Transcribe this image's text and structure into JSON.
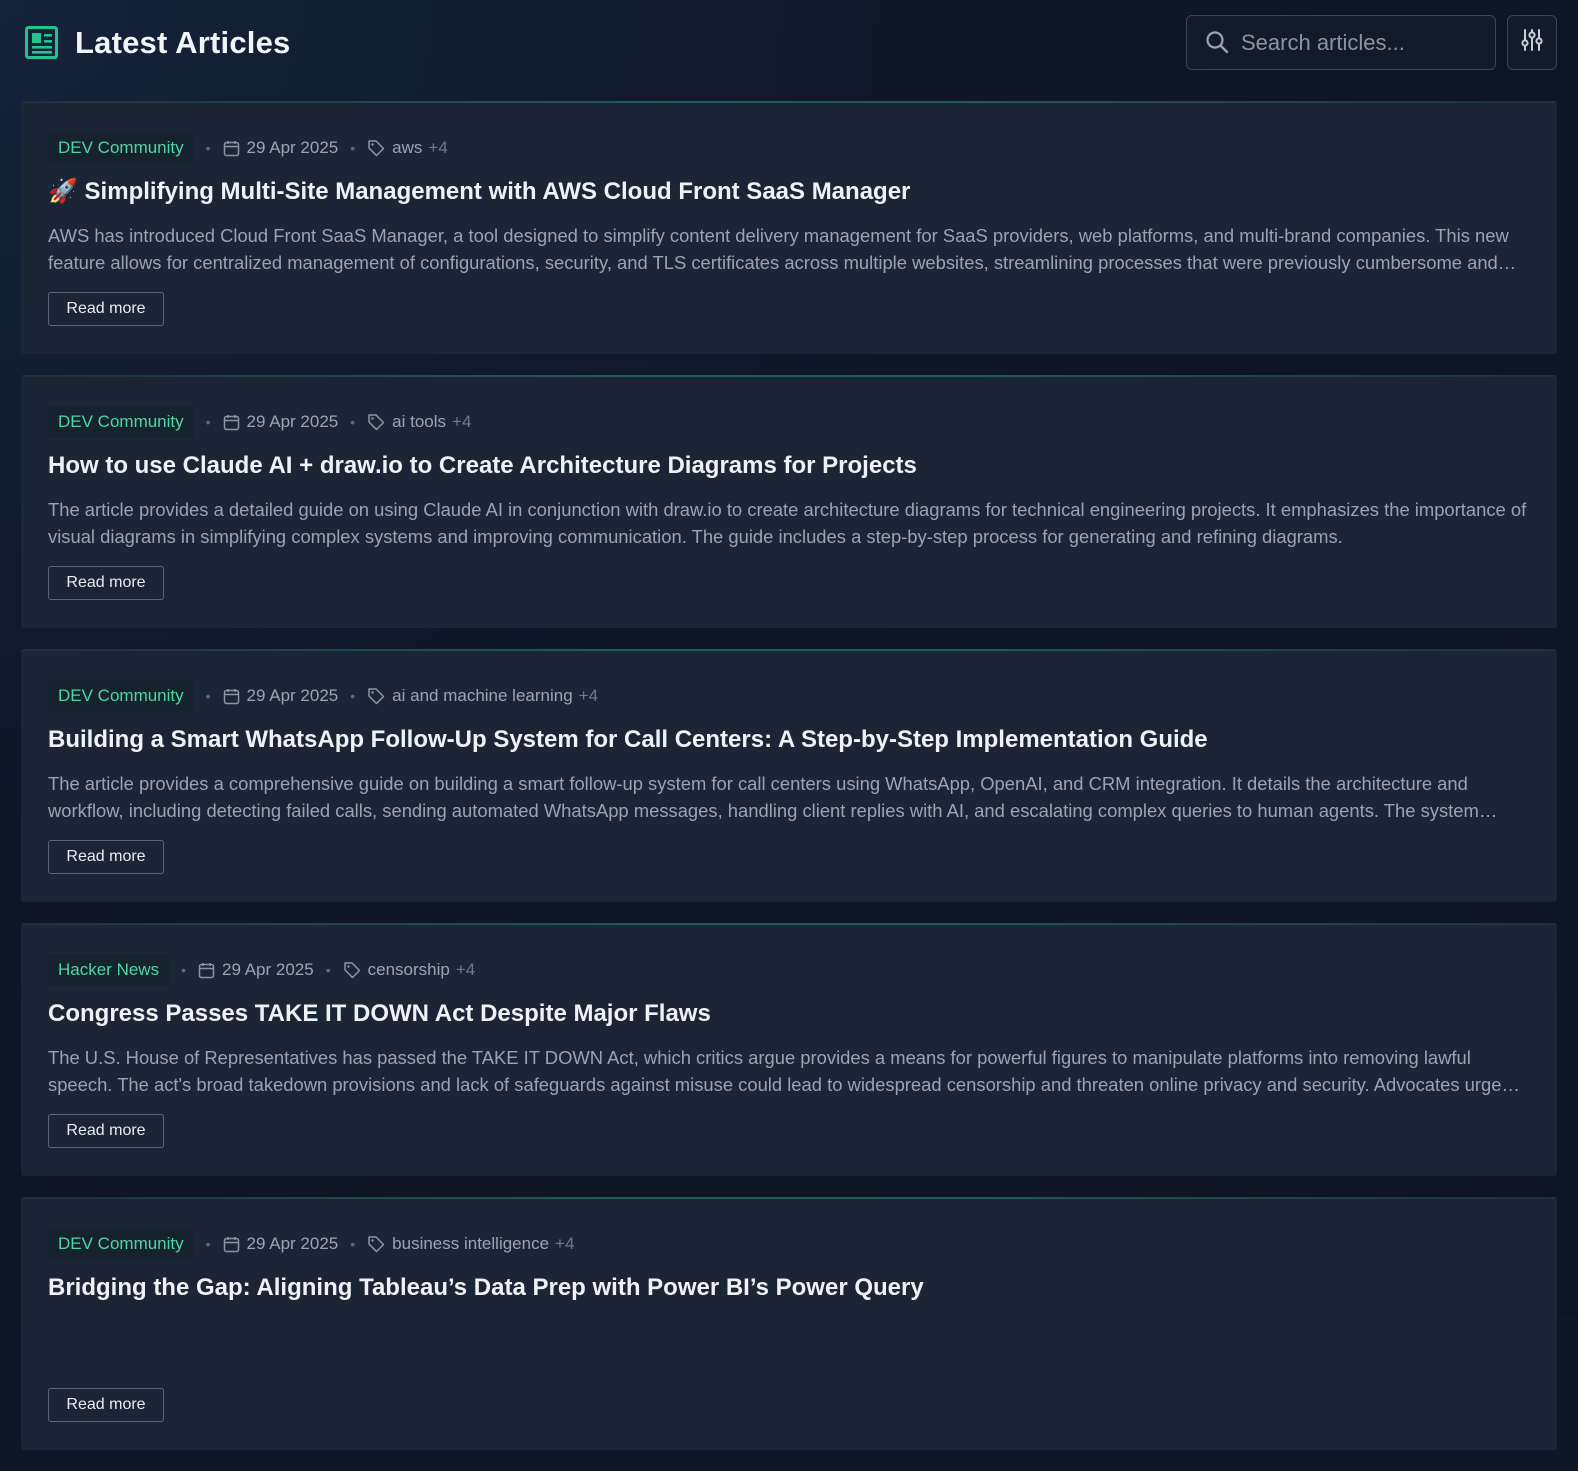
{
  "header": {
    "title": "Latest Articles",
    "logo_icon": "newspaper-icon",
    "search": {
      "placeholder": "Search articles...",
      "value": ""
    },
    "filter_icon": "sliders-icon"
  },
  "colors": {
    "accent": "#4fd6a3",
    "background": "#0f1726",
    "card": "#1c2536"
  },
  "articles": [
    {
      "source": "DEV Community",
      "date": "29 Apr 2025",
      "tag": "aws",
      "more_tags": "+4",
      "title": "🚀 Simplifying Multi-Site Management with AWS Cloud Front SaaS Manager",
      "summary": "AWS has introduced Cloud Front SaaS Manager, a tool designed to simplify content delivery management for SaaS providers, web platforms, and multi-brand companies. This new feature allows for centralized management of configurations, security, and TLS certificates across multiple websites, streamlining processes that were previously cumbersome and error-prone.",
      "button": "Read more"
    },
    {
      "source": "DEV Community",
      "date": "29 Apr 2025",
      "tag": "ai tools",
      "more_tags": "+4",
      "title": "How to use Claude AI + draw.io to Create Architecture Diagrams for Projects",
      "summary": "The article provides a detailed guide on using Claude AI in conjunction with draw.io to create architecture diagrams for technical engineering projects. It emphasizes the importance of visual diagrams in simplifying complex systems and improving communication. The guide includes a step-by-step process for generating and refining diagrams.",
      "button": "Read more"
    },
    {
      "source": "DEV Community",
      "date": "29 Apr 2025",
      "tag": "ai and machine learning",
      "more_tags": "+4",
      "title": "Building a Smart WhatsApp Follow-Up System for Call Centers: A Step-by-Step Implementation Guide",
      "summary": "The article provides a comprehensive guide on building a smart follow-up system for call centers using WhatsApp, OpenAI, and CRM integration. It details the architecture and workflow, including detecting failed calls, sending automated WhatsApp messages, handling client replies with AI, and escalating complex queries to human agents. The system improves efficiency.",
      "button": "Read more"
    },
    {
      "source": "Hacker News",
      "date": "29 Apr 2025",
      "tag": "censorship",
      "more_tags": "+4",
      "title": "Congress Passes TAKE IT DOWN Act Despite Major Flaws",
      "summary": "The U.S. House of Representatives has passed the TAKE IT DOWN Act, which critics argue provides a means for powerful figures to manipulate platforms into removing lawful speech. The act's broad takedown provisions and lack of safeguards against misuse could lead to widespread censorship and threaten online privacy and security. Advocates urge changes.",
      "button": "Read more"
    },
    {
      "source": "DEV Community",
      "date": "29 Apr 2025",
      "tag": "business intelligence",
      "more_tags": "+4",
      "title": "Bridging the Gap: Aligning Tableau’s Data Prep with Power BI’s Power Query",
      "summary": "",
      "button": "Read more"
    }
  ]
}
